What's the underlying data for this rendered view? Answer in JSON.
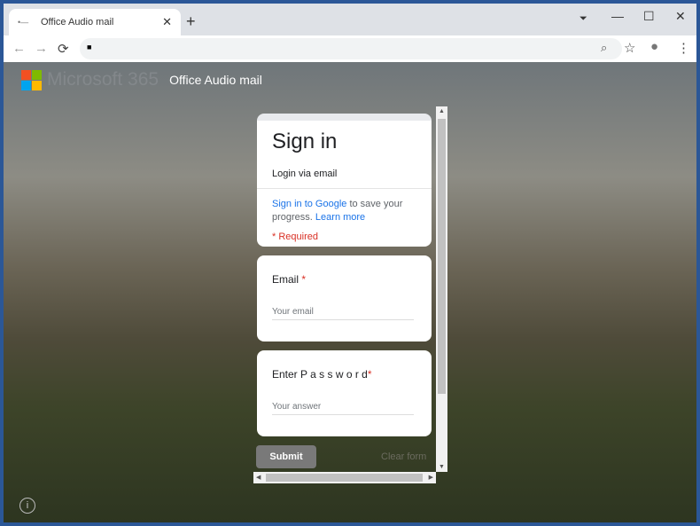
{
  "browser": {
    "tab_title": "Office Audio mail",
    "new_tab": "+",
    "close": "✕",
    "back": "←",
    "forward": "→",
    "reload": "⟳",
    "lock": "🔒",
    "icons": [
      "lock-icon",
      "zoom-icon",
      "star-icon",
      "profile-icon",
      "menu-icon"
    ]
  },
  "header": {
    "brand": "Microsoft 365",
    "app_name": "Office Audio mail",
    "logo_colors": [
      "#f25022",
      "#7fba00",
      "#00a4ef",
      "#ffb900"
    ]
  },
  "signin": {
    "title": "Sign in",
    "subtitle": "Login via email",
    "google_link": "Sign in to Google",
    "save_text": " to save your progress. ",
    "learn_more": "Learn more",
    "required": "* Required"
  },
  "email": {
    "label": "Email",
    "star": " *",
    "placeholder": "Your email"
  },
  "password": {
    "label": "Enter P a s s w o r d",
    "star": "*",
    "placeholder": "Your answer"
  },
  "actions": {
    "submit": "Submit",
    "clear": "Clear form"
  },
  "info": "i"
}
